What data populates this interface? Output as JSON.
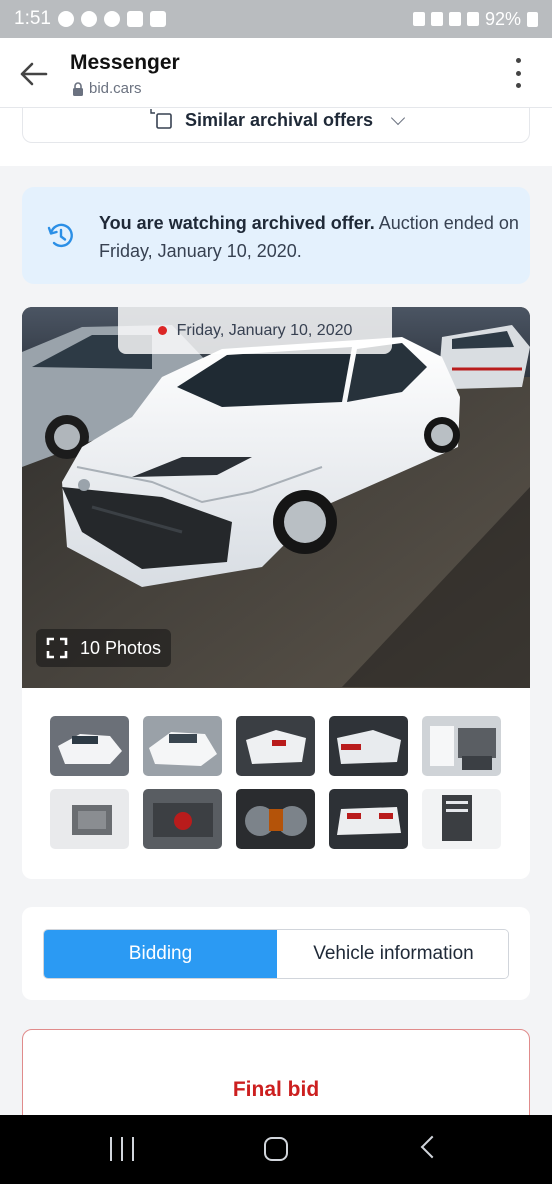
{
  "status_bar": {
    "time": "1:51",
    "battery": "92%",
    "icons": [
      "messenger-icon",
      "facebook-icon",
      "facebook-icon",
      "instagram-icon",
      "gallery-icon",
      "nfc-icon",
      "alarm-icon",
      "signal-icon",
      "4g-icon",
      "battery-icon"
    ]
  },
  "app_bar": {
    "title": "Messenger",
    "url": "bid.cars"
  },
  "similar": {
    "label": "Similar archival offers"
  },
  "notice": {
    "bold": "You are watching archived offer.",
    "text": " Auction ended on Friday, January 10, 2020."
  },
  "gallery": {
    "date": "Friday, January 10, 2020",
    "photos_label": "10 Photos",
    "thumbnail_count": 10
  },
  "tabs": {
    "bidding": "Bidding",
    "vehicle_info": "Vehicle information",
    "active": "bidding"
  },
  "bid": {
    "title": "Final bid"
  },
  "colors": {
    "accent": "#2b9af3",
    "notice_bg": "#e4f1fd",
    "bid_red": "#cc1f1f"
  }
}
